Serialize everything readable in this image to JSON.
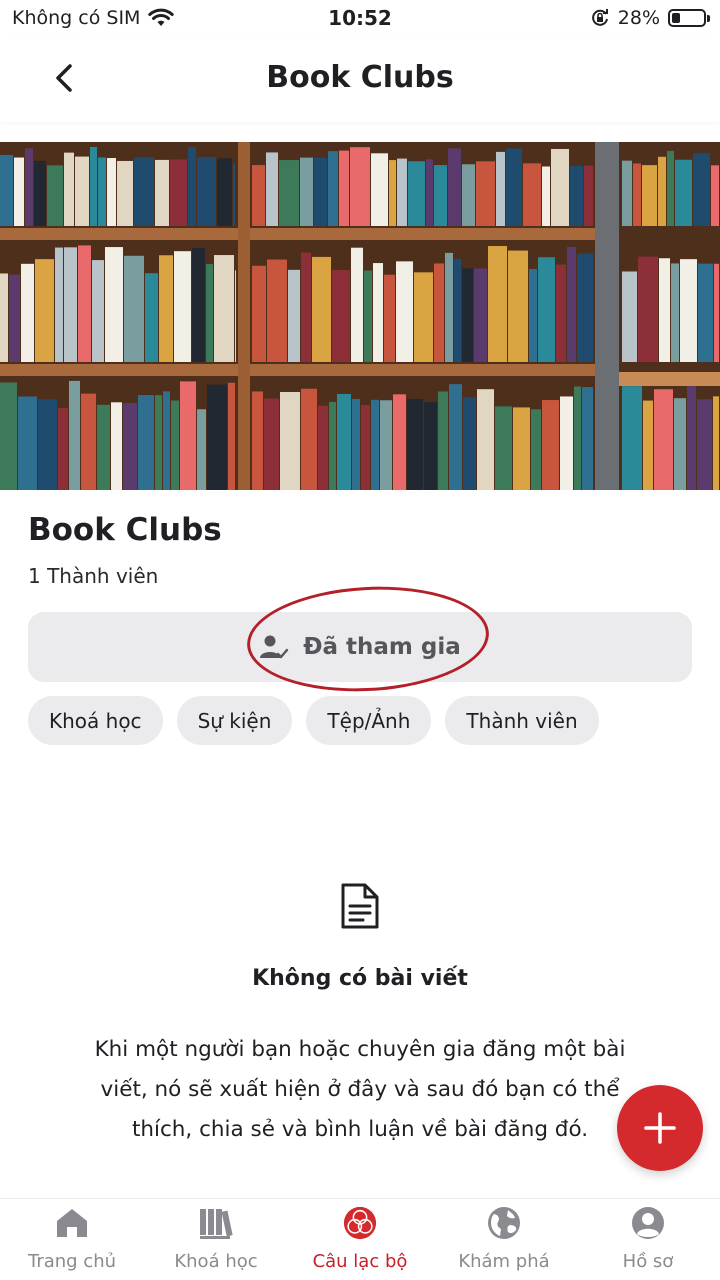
{
  "status_bar": {
    "carrier": "Không có SIM",
    "time": "10:52",
    "battery": "28%",
    "battery_level": 0.28,
    "icons": [
      "wifi-icon",
      "orientation-lock-icon",
      "battery-icon"
    ]
  },
  "header": {
    "title": "Book Clubs",
    "back_icon": "chevron-left-icon"
  },
  "club": {
    "name": "Book Clubs",
    "members": "1 Thành viên",
    "joined_label": "Đã tham gia"
  },
  "tabs": [
    "Khoá học",
    "Sự kiện",
    "Tệp/Ảnh",
    "Thành viên"
  ],
  "empty_state": {
    "icon": "document-icon",
    "title": "Không có bài viết",
    "description": "Khi một người bạn hoặc chuyên gia đăng một bài viết, nó sẽ xuất hiện ở đây và sau đó bạn có thể thích, chia sẻ và bình luận về bài đăng đó."
  },
  "fab_icon": "plus-icon",
  "bottom_nav": [
    {
      "label": "Trang chủ",
      "icon": "home-icon"
    },
    {
      "label": "Khoá học",
      "icon": "books-icon"
    },
    {
      "label": "Câu lạc bộ",
      "icon": "club-icon",
      "active": true
    },
    {
      "label": "Khám phá",
      "icon": "globe-icon"
    },
    {
      "label": "Hồ sơ",
      "icon": "profile-icon"
    }
  ],
  "colors": {
    "accent": "#d42a2e",
    "chip_bg": "#ebebee",
    "inactive": "#8a8a90",
    "annotation": "#b3202a"
  }
}
